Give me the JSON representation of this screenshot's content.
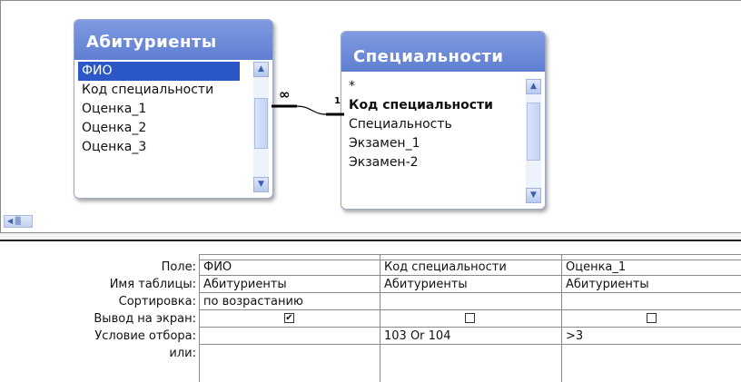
{
  "tables": [
    {
      "title": "Абитуриенты",
      "fields": [
        "ФИО",
        "Код специальности",
        "Оценка_1",
        "Оценка_2",
        "Оценка_3"
      ],
      "selected_index": 0
    },
    {
      "title": "Специальности",
      "fields": [
        "*",
        "Код специальности",
        "Специальность",
        "Экзамен_1",
        "Экзамен-2"
      ],
      "bold_index": 1
    }
  ],
  "relationship": {
    "many_label": "∞",
    "one_label": "1"
  },
  "grid": {
    "row_labels": [
      "Поле:",
      "Имя таблицы:",
      "Сортировка:",
      "Вывод на экран:",
      "Условие отбора:",
      "или:"
    ],
    "columns": [
      {
        "field": "ФИО",
        "table": "Абитуриенты",
        "sort": "по возрастанию",
        "show": true,
        "criteria": "",
        "or": ""
      },
      {
        "field": "Код специальности",
        "table": "Абитуриенты",
        "sort": "",
        "show": false,
        "criteria": "103 Or 104",
        "or": ""
      },
      {
        "field": "Оценка_1",
        "table": "Абитуриенты",
        "sort": "",
        "show": false,
        "criteria": ">3",
        "or": ""
      }
    ]
  },
  "colors": {
    "title_bar": "#6f8cdb",
    "selection": "#2c58c7",
    "grid_lines": "#8a8a8a"
  }
}
